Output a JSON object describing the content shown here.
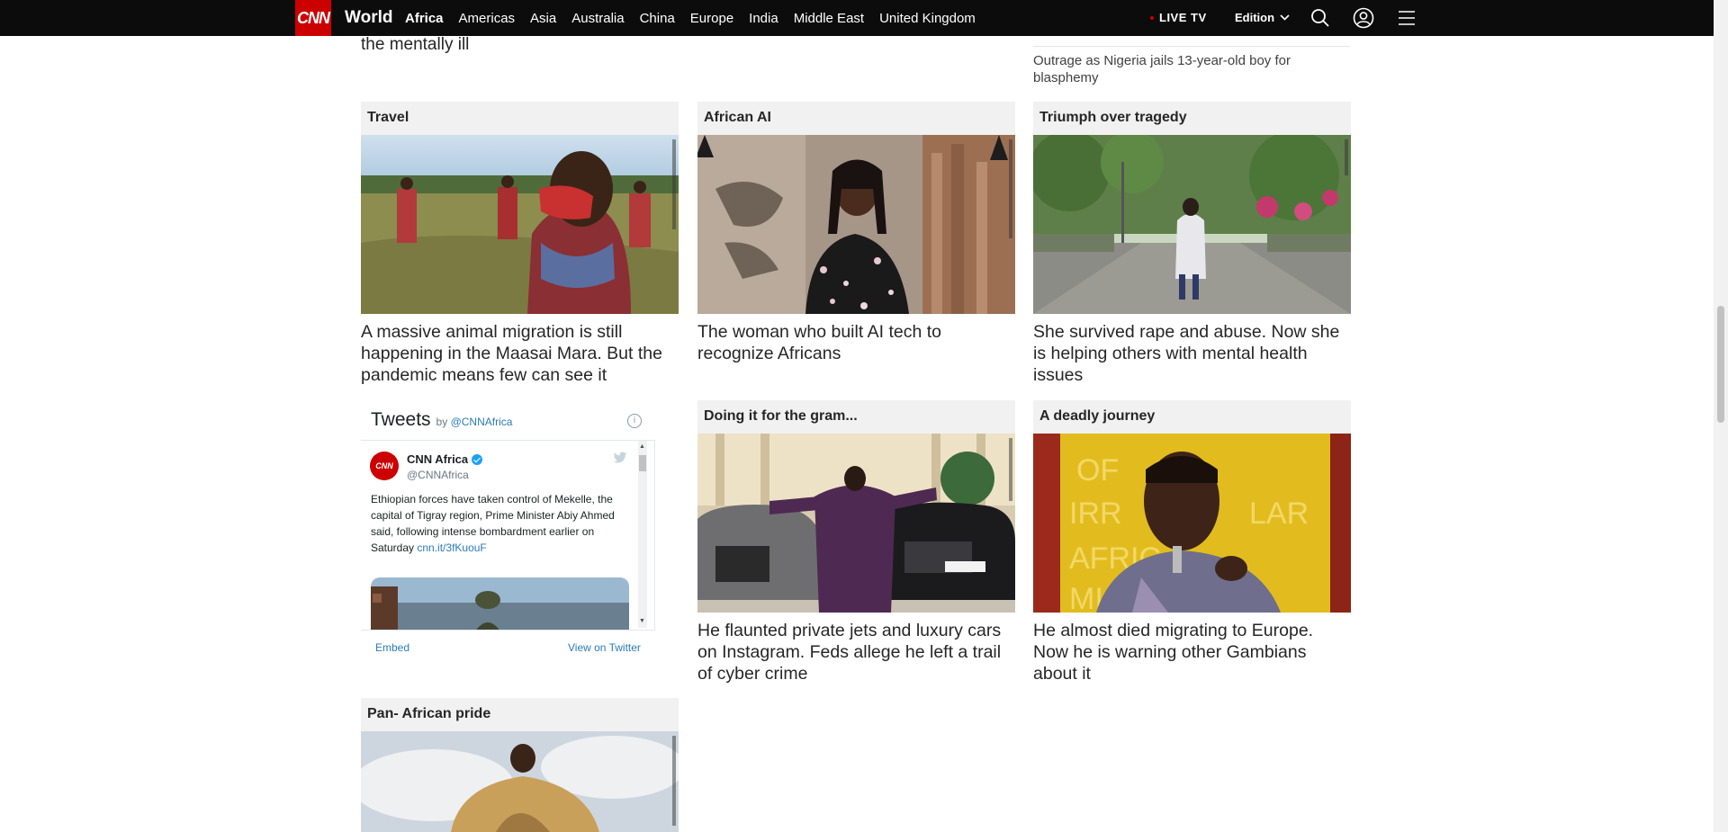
{
  "nav": {
    "logo": "CNN",
    "section": "World",
    "links": [
      "Africa",
      "Americas",
      "Asia",
      "Australia",
      "China",
      "Europe",
      "India",
      "Middle East",
      "United Kingdom"
    ],
    "active": "Africa",
    "live_tv": "LIVE TV",
    "edition": "Edition",
    "icons": [
      "search-icon",
      "account-icon",
      "menu-icon"
    ]
  },
  "top": {
    "cutoff_headline": "the mentally ill",
    "right_link": "Outrage as Nigeria jails 13-year-old boy for blasphemy"
  },
  "cards": [
    {
      "label": "Travel",
      "headline": "A massive animal migration is still happening in the Maasai Mara. But the pandemic means few can see it"
    },
    {
      "label": "African AI",
      "headline": "The woman who built AI tech to recognize Africans"
    },
    {
      "label": "Triumph over tragedy",
      "headline": "She survived rape and abuse. Now she is helping others with mental health issues"
    },
    {
      "label": "Doing it for the gram...",
      "headline": "He flaunted private jets and luxury cars on Instagram. Feds allege he left a trail of cyber crime"
    },
    {
      "label": "A deadly journey",
      "headline": "He almost died migrating to Europe. Now he is warning other Gambians about it"
    },
    {
      "label": "Pan- African pride",
      "headline": ""
    }
  ],
  "tweets": {
    "title": "Tweets",
    "by": "by",
    "handle": "@CNNAfrica",
    "account_name": "CNN Africa",
    "account_handle": "@CNNAfrica",
    "avatar_text": "CNN",
    "text": "Ethiopian forces have taken control of Mekelle, the capital of Tigray region, Prime Minister Abiy Ahmed said, following intense bombardment earlier on Saturday",
    "link": "cnn.it/3fKuouF",
    "embed": "Embed",
    "view_on_twitter": "View on Twitter"
  },
  "colors": {
    "nav_bg": "#0c0c0c",
    "brand_red": "#cc0000",
    "label_bg": "#f1f1f1",
    "twitter_blue": "#2b7bb9"
  }
}
